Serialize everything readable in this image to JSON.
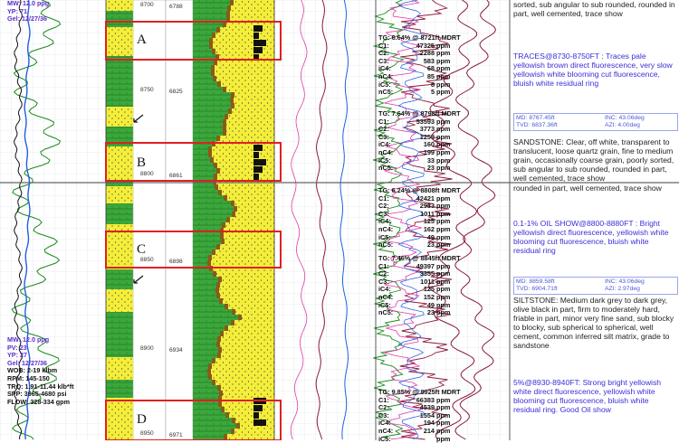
{
  "colors": {
    "highlight_box": "#e02020",
    "sand_yellow": "#f4ee3a",
    "shale_green": "#3aa83a",
    "depth_track": "#ffffff",
    "desc_blue": "#3a2fd6",
    "meta_blue": "#4b59d8",
    "gr_curve": "#1b8a1b",
    "rop_curve": "#2060e0"
  },
  "header_readout": {
    "mw": "MW: 12.0 ppg",
    "yp": "YP: 71",
    "gel": "Gel: 12/27/36"
  },
  "mid_readout": {
    "mw": "MW: 12.0 ppg",
    "pv": "PV: 23",
    "yp": "YP: 27",
    "gel": "Gel: 12/27/36",
    "wob": "WOB: 2-19 klbm",
    "rpm": "RPM: 145-150",
    "trq": "TRQ: 1.91-11.44 klb*ft",
    "spp": "SPP: 3965-4680 psi",
    "flow": "FLOW: 328-334 gpm"
  },
  "depth_labels": {
    "md": [
      "8700",
      "8750",
      "8800",
      "8850",
      "8900",
      "8950"
    ],
    "tvd": [
      "6788",
      "6825",
      "6861",
      "6898",
      "6934",
      "6971"
    ]
  },
  "box_labels": [
    "A",
    "B",
    "C",
    "D"
  ],
  "gas_blocks": [
    {
      "header": "TG: 6.64% @ 8721ft MDRT",
      "rows": [
        {
          "k": "C1:",
          "v": "47325",
          "u": "ppm"
        },
        {
          "k": "C2:",
          "v": "2288",
          "u": "ppm"
        },
        {
          "k": "C3:",
          "v": "583",
          "u": "ppm"
        },
        {
          "k": "iC4:",
          "v": "68",
          "u": "ppm"
        },
        {
          "k": "nC4:",
          "v": "85",
          "u": "ppm"
        },
        {
          "k": "iC5:",
          "v": "8",
          "u": "ppm"
        },
        {
          "k": "nC5:",
          "v": "5",
          "u": "ppm"
        }
      ]
    },
    {
      "header": "TG: 7.64% @ 8798ft MDRT",
      "rows": [
        {
          "k": "C1:",
          "v": "53593",
          "u": "ppm"
        },
        {
          "k": "C2:",
          "v": "3773",
          "u": "ppm"
        },
        {
          "k": "C3:",
          "v": "1253",
          "u": "ppm"
        },
        {
          "k": "iC4:",
          "v": "160",
          "u": "ppm"
        },
        {
          "k": "nC4:",
          "v": "199",
          "u": "ppm"
        },
        {
          "k": "iC5:",
          "v": "33",
          "u": "ppm"
        },
        {
          "k": "nC5:",
          "v": "23",
          "u": "ppm"
        }
      ]
    },
    {
      "header": "TG: 6.24% @ 8808ft MDRT",
      "rows": [
        {
          "k": "C1:",
          "v": "42421",
          "u": "ppm"
        },
        {
          "k": "C2:",
          "v": "2933",
          "u": "ppm"
        },
        {
          "k": "C3:",
          "v": "1011",
          "u": "ppm"
        },
        {
          "k": "iC4:",
          "v": "125",
          "u": "ppm"
        },
        {
          "k": "nC4:",
          "v": "162",
          "u": "ppm"
        },
        {
          "k": "iC5:",
          "v": "49",
          "u": "ppm"
        },
        {
          "k": "nC5:",
          "v": "23",
          "u": "ppm"
        }
      ]
    },
    {
      "header": "TG: 7.46% @ 8845ft MDRT",
      "rows": [
        {
          "k": "C1:",
          "v": "49397",
          "u": "ppm"
        },
        {
          "k": "C2:",
          "v": "3355",
          "u": "ppm"
        },
        {
          "k": "C3:",
          "v": "1011",
          "u": "ppm"
        },
        {
          "k": "iC4:",
          "v": "125",
          "u": "ppm"
        },
        {
          "k": "nC4:",
          "v": "152",
          "u": "ppm"
        },
        {
          "k": "iC5:",
          "v": "49",
          "u": "ppm"
        },
        {
          "k": "nC5:",
          "v": "23",
          "u": "ppm"
        }
      ]
    },
    {
      "header": "TG: 9.85% @ 8925ft MDRT",
      "rows": [
        {
          "k": "C1:",
          "v": "66383",
          "u": "ppm"
        },
        {
          "k": "C2:",
          "v": "4539",
          "u": "ppm"
        },
        {
          "k": "C3:",
          "v": "1554",
          "u": "ppm"
        },
        {
          "k": "iC4:",
          "v": "194",
          "u": "ppm"
        },
        {
          "k": "nC4:",
          "v": "214",
          "u": "ppm"
        },
        {
          "k": "iC5:",
          "v": "",
          "u": "ppm"
        }
      ]
    }
  ],
  "descriptions": {
    "top_partial": "sorted, sub angular to sub rounded, rounded in part, well cemented, trace show",
    "traces": "TRACES@8730-8750FT : Traces pale yellowish brown direct fluorescence, very slow yellowish white blooming cut fluorescence, bluish white residual ring",
    "sandstone": "SANDSTONE: Clear, off white, transparent to translucent, loose quartz grain, fine to medium grain, occasionally coarse grain, poorly sorted, sub angular to sub rounded, rounded in part, well cemented, trace show",
    "mid_partial": "rounded in part, well cemented, trace show",
    "oil_show": "0.1-1% OIL SHOW@8800-8880FT : Bright yellowish direct fluorescence, yellowish white blooming cut fluorescence, bluish white residual ring",
    "siltstone": "SILTSTONE: Medium dark grey to dark grey, olive black in part, firm to moderately hard, friable in part, minor very fine sand, sub blocky to blocky, sub spherical to spherical, well cement, common inferred silt matrix, grade to sandstone",
    "strong": "5%@8930-8940FT: Strong bright yellowish white direct fluorescence, yellowish white blooming cut fluorescence, bluish white residual ring. Good Oil show"
  },
  "survey": [
    {
      "md": "MD: 8767.45ft",
      "inc": "INC: 43.06deg",
      "tvd": "TVD: 6837.36ft",
      "azi": "AZI: 4.00deg"
    },
    {
      "md": "MD: 8859.58ft",
      "inc": "INC: 43.06deg",
      "tvd": "TVD: 6904.71ft",
      "azi": "AZI: 2.97deg"
    }
  ]
}
